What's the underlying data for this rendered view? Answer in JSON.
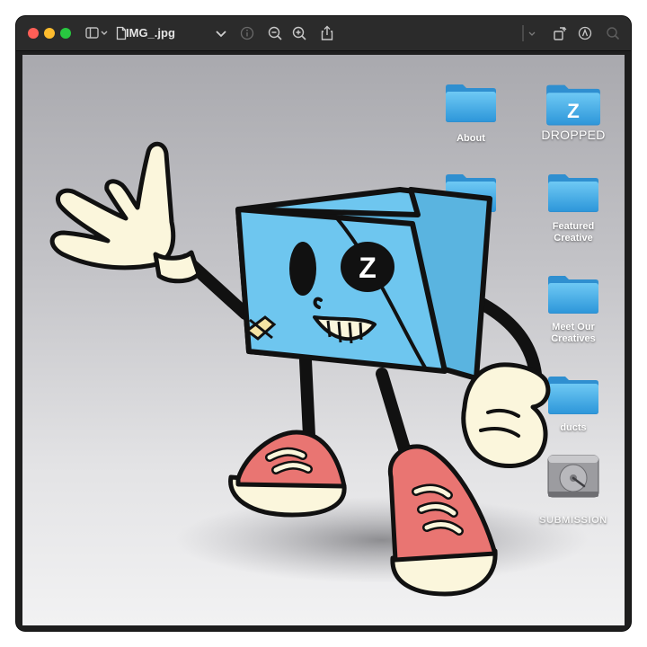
{
  "window": {
    "title": "IMG_.jpg",
    "traffic_lights": {
      "close": "#ff5f57",
      "minimize": "#febc2e",
      "zoom": "#28c840"
    },
    "toolbar_icons": [
      "sidebar-icon",
      "chevron-down-icon",
      "document-icon",
      "info-icon",
      "zoom-out-icon",
      "zoom-in-icon",
      "share-icon",
      "rotate-icon",
      "markup-icon",
      "search-icon"
    ]
  },
  "desktop": {
    "background": [
      "#a9a9ae",
      "#f2f2f3"
    ],
    "folder_color": "#3fa9ea",
    "folders": [
      {
        "label": "About"
      },
      {
        "label": "DROPPED",
        "glyph": "Z"
      },
      {
        "label": ""
      },
      {
        "label": "Featured\nCreative"
      },
      {
        "label": "Meet Our\nCreatives"
      },
      {
        "label": "ducts"
      }
    ],
    "drive": {
      "label": "SUBMISSION"
    }
  },
  "mascot": {
    "body_color": "#6ec6ef",
    "shoe_color": "#e97572",
    "glove_color": "#fbf6dc",
    "eye_patch_glyph": "Z"
  }
}
